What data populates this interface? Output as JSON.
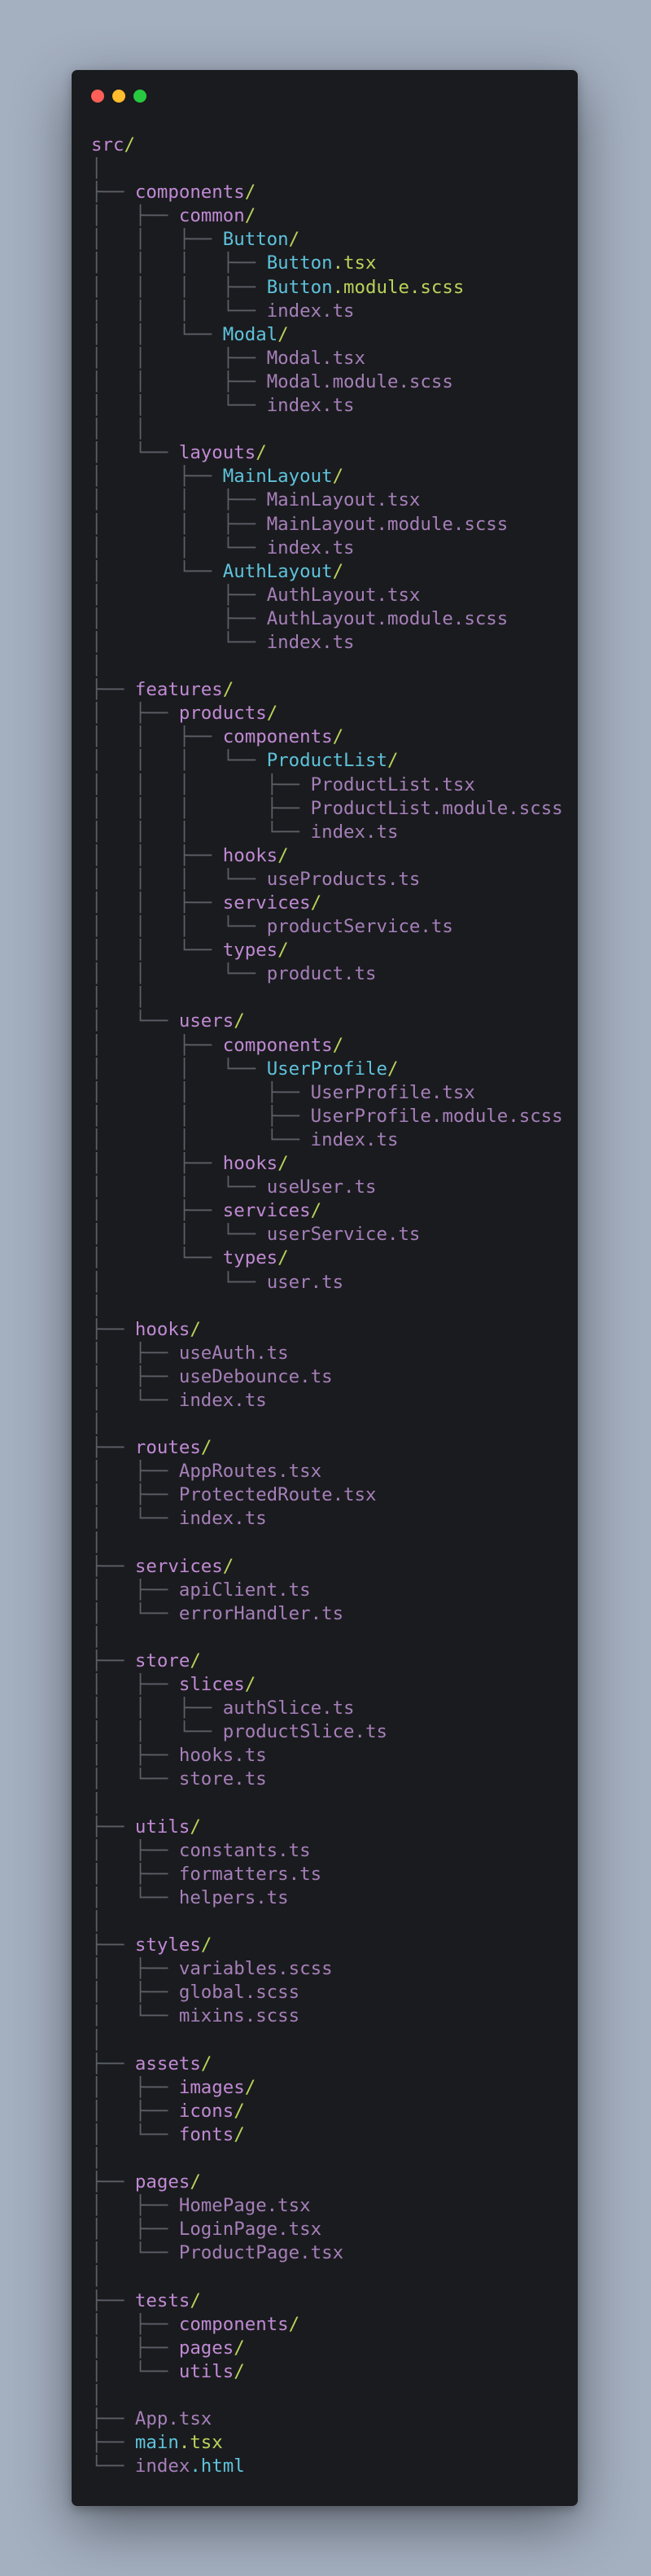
{
  "window": {
    "controls": [
      {
        "name": "close",
        "color": "#ff5f57"
      },
      {
        "name": "minimize",
        "color": "#febc2e"
      },
      {
        "name": "zoom",
        "color": "#28c840"
      }
    ]
  },
  "colors": {
    "background": "#a4afc0",
    "window": "#1a1b1e",
    "tree_chars": "#5b5f66",
    "directory": "#c08ad4",
    "file": "#a57fb9",
    "highlight": "#5ec3dc",
    "slash_and_extension": "#b8d35a"
  },
  "tree": [
    {
      "prefix": "",
      "name": "src",
      "suffix": "/",
      "kind": "dir"
    },
    {
      "prefix": "│",
      "name": "",
      "suffix": "",
      "kind": "blank"
    },
    {
      "prefix": "├── ",
      "name": "components",
      "suffix": "/",
      "kind": "dir"
    },
    {
      "prefix": "│   ├── ",
      "name": "common",
      "suffix": "/",
      "kind": "dir"
    },
    {
      "prefix": "│   │   ├── ",
      "name": "Button",
      "suffix": "/",
      "kind": "cyan"
    },
    {
      "prefix": "│   │   │   ├── ",
      "name": "Button",
      "suffix": ".tsx",
      "kind": "cyan-green"
    },
    {
      "prefix": "│   │   │   ├── ",
      "name": "Button",
      "suffix": ".module.scss",
      "kind": "cyan-green"
    },
    {
      "prefix": "│   │   │   └── ",
      "name": "index.ts",
      "suffix": "",
      "kind": "file"
    },
    {
      "prefix": "│   │   └── ",
      "name": "Modal",
      "suffix": "/",
      "kind": "cyan"
    },
    {
      "prefix": "│   │       ├── ",
      "name": "Modal.tsx",
      "suffix": "",
      "kind": "file"
    },
    {
      "prefix": "│   │       ├── ",
      "name": "Modal.module.scss",
      "suffix": "",
      "kind": "file"
    },
    {
      "prefix": "│   │       └── ",
      "name": "index.ts",
      "suffix": "",
      "kind": "file"
    },
    {
      "prefix": "│   │",
      "name": "",
      "suffix": "",
      "kind": "blank"
    },
    {
      "prefix": "│   └── ",
      "name": "layouts",
      "suffix": "/",
      "kind": "dir"
    },
    {
      "prefix": "│       ├── ",
      "name": "MainLayout",
      "suffix": "/",
      "kind": "cyan"
    },
    {
      "prefix": "│       │   ├── ",
      "name": "MainLayout.tsx",
      "suffix": "",
      "kind": "file"
    },
    {
      "prefix": "│       │   ├── ",
      "name": "MainLayout.module.scss",
      "suffix": "",
      "kind": "file"
    },
    {
      "prefix": "│       │   └── ",
      "name": "index.ts",
      "suffix": "",
      "kind": "file"
    },
    {
      "prefix": "│       └── ",
      "name": "AuthLayout",
      "suffix": "/",
      "kind": "cyan"
    },
    {
      "prefix": "│           ├── ",
      "name": "AuthLayout.tsx",
      "suffix": "",
      "kind": "file"
    },
    {
      "prefix": "│           ├── ",
      "name": "AuthLayout.module.scss",
      "suffix": "",
      "kind": "file"
    },
    {
      "prefix": "│           └── ",
      "name": "index.ts",
      "suffix": "",
      "kind": "file"
    },
    {
      "prefix": "│",
      "name": "",
      "suffix": "",
      "kind": "blank"
    },
    {
      "prefix": "├── ",
      "name": "features",
      "suffix": "/",
      "kind": "dir"
    },
    {
      "prefix": "│   ├── ",
      "name": "products",
      "suffix": "/",
      "kind": "dir"
    },
    {
      "prefix": "│   │   ├── ",
      "name": "components",
      "suffix": "/",
      "kind": "dir"
    },
    {
      "prefix": "│   │   │   └── ",
      "name": "ProductList",
      "suffix": "/",
      "kind": "cyan"
    },
    {
      "prefix": "│   │   │       ├── ",
      "name": "ProductList.tsx",
      "suffix": "",
      "kind": "file"
    },
    {
      "prefix": "│   │   │       ├── ",
      "name": "ProductList.module.scss",
      "suffix": "",
      "kind": "file"
    },
    {
      "prefix": "│   │   │       └── ",
      "name": "index.ts",
      "suffix": "",
      "kind": "file"
    },
    {
      "prefix": "│   │   ├── ",
      "name": "hooks",
      "suffix": "/",
      "kind": "dir"
    },
    {
      "prefix": "│   │   │   └── ",
      "name": "useProducts.ts",
      "suffix": "",
      "kind": "file"
    },
    {
      "prefix": "│   │   ├── ",
      "name": "services",
      "suffix": "/",
      "kind": "dir"
    },
    {
      "prefix": "│   │   │   └── ",
      "name": "productService.ts",
      "suffix": "",
      "kind": "file"
    },
    {
      "prefix": "│   │   └── ",
      "name": "types",
      "suffix": "/",
      "kind": "dir"
    },
    {
      "prefix": "│   │       └── ",
      "name": "product.ts",
      "suffix": "",
      "kind": "file"
    },
    {
      "prefix": "│   │",
      "name": "",
      "suffix": "",
      "kind": "blank"
    },
    {
      "prefix": "│   └── ",
      "name": "users",
      "suffix": "/",
      "kind": "dir"
    },
    {
      "prefix": "│       ├── ",
      "name": "components",
      "suffix": "/",
      "kind": "dir"
    },
    {
      "prefix": "│       │   └── ",
      "name": "UserProfile",
      "suffix": "/",
      "kind": "cyan"
    },
    {
      "prefix": "│       │       ├── ",
      "name": "UserProfile.tsx",
      "suffix": "",
      "kind": "file"
    },
    {
      "prefix": "│       │       ├── ",
      "name": "UserProfile.module.scss",
      "suffix": "",
      "kind": "file"
    },
    {
      "prefix": "│       │       └── ",
      "name": "index.ts",
      "suffix": "",
      "kind": "file"
    },
    {
      "prefix": "│       ├── ",
      "name": "hooks",
      "suffix": "/",
      "kind": "dir"
    },
    {
      "prefix": "│       │   └── ",
      "name": "useUser.ts",
      "suffix": "",
      "kind": "file"
    },
    {
      "prefix": "│       ├── ",
      "name": "services",
      "suffix": "/",
      "kind": "dir"
    },
    {
      "prefix": "│       │   └── ",
      "name": "userService.ts",
      "suffix": "",
      "kind": "file"
    },
    {
      "prefix": "│       └── ",
      "name": "types",
      "suffix": "/",
      "kind": "dir"
    },
    {
      "prefix": "│           └── ",
      "name": "user.ts",
      "suffix": "",
      "kind": "file"
    },
    {
      "prefix": "│",
      "name": "",
      "suffix": "",
      "kind": "blank"
    },
    {
      "prefix": "├── ",
      "name": "hooks",
      "suffix": "/",
      "kind": "dir"
    },
    {
      "prefix": "│   ├── ",
      "name": "useAuth.ts",
      "suffix": "",
      "kind": "file"
    },
    {
      "prefix": "│   ├── ",
      "name": "useDebounce.ts",
      "suffix": "",
      "kind": "file"
    },
    {
      "prefix": "│   └── ",
      "name": "index.ts",
      "suffix": "",
      "kind": "file"
    },
    {
      "prefix": "│",
      "name": "",
      "suffix": "",
      "kind": "blank"
    },
    {
      "prefix": "├── ",
      "name": "routes",
      "suffix": "/",
      "kind": "dir"
    },
    {
      "prefix": "│   ├── ",
      "name": "AppRoutes.tsx",
      "suffix": "",
      "kind": "file"
    },
    {
      "prefix": "│   ├── ",
      "name": "ProtectedRoute.tsx",
      "suffix": "",
      "kind": "file"
    },
    {
      "prefix": "│   └── ",
      "name": "index.ts",
      "suffix": "",
      "kind": "file"
    },
    {
      "prefix": "│",
      "name": "",
      "suffix": "",
      "kind": "blank"
    },
    {
      "prefix": "├── ",
      "name": "services",
      "suffix": "/",
      "kind": "dir"
    },
    {
      "prefix": "│   ├── ",
      "name": "apiClient.ts",
      "suffix": "",
      "kind": "file"
    },
    {
      "prefix": "│   └── ",
      "name": "errorHandler.ts",
      "suffix": "",
      "kind": "file"
    },
    {
      "prefix": "│",
      "name": "",
      "suffix": "",
      "kind": "blank"
    },
    {
      "prefix": "├── ",
      "name": "store",
      "suffix": "/",
      "kind": "dir"
    },
    {
      "prefix": "│   ├── ",
      "name": "slices",
      "suffix": "/",
      "kind": "dir"
    },
    {
      "prefix": "│   │   ├── ",
      "name": "authSlice.ts",
      "suffix": "",
      "kind": "file"
    },
    {
      "prefix": "│   │   └── ",
      "name": "productSlice.ts",
      "suffix": "",
      "kind": "file"
    },
    {
      "prefix": "│   ├── ",
      "name": "hooks.ts",
      "suffix": "",
      "kind": "file"
    },
    {
      "prefix": "│   └── ",
      "name": "store.ts",
      "suffix": "",
      "kind": "file"
    },
    {
      "prefix": "│",
      "name": "",
      "suffix": "",
      "kind": "blank"
    },
    {
      "prefix": "├── ",
      "name": "utils",
      "suffix": "/",
      "kind": "dir"
    },
    {
      "prefix": "│   ├── ",
      "name": "constants.ts",
      "suffix": "",
      "kind": "file"
    },
    {
      "prefix": "│   ├── ",
      "name": "formatters.ts",
      "suffix": "",
      "kind": "file"
    },
    {
      "prefix": "│   └── ",
      "name": "helpers.ts",
      "suffix": "",
      "kind": "file"
    },
    {
      "prefix": "│",
      "name": "",
      "suffix": "",
      "kind": "blank"
    },
    {
      "prefix": "├── ",
      "name": "styles",
      "suffix": "/",
      "kind": "dir"
    },
    {
      "prefix": "│   ├── ",
      "name": "variables.scss",
      "suffix": "",
      "kind": "file"
    },
    {
      "prefix": "│   ├── ",
      "name": "global.scss",
      "suffix": "",
      "kind": "file"
    },
    {
      "prefix": "│   └── ",
      "name": "mixins.scss",
      "suffix": "",
      "kind": "file"
    },
    {
      "prefix": "│",
      "name": "",
      "suffix": "",
      "kind": "blank"
    },
    {
      "prefix": "├── ",
      "name": "assets",
      "suffix": "/",
      "kind": "dir"
    },
    {
      "prefix": "│   ├── ",
      "name": "images",
      "suffix": "/",
      "kind": "dir"
    },
    {
      "prefix": "│   ├── ",
      "name": "icons",
      "suffix": "/",
      "kind": "dir"
    },
    {
      "prefix": "│   └── ",
      "name": "fonts",
      "suffix": "/",
      "kind": "dir"
    },
    {
      "prefix": "│",
      "name": "",
      "suffix": "",
      "kind": "blank"
    },
    {
      "prefix": "├── ",
      "name": "pages",
      "suffix": "/",
      "kind": "dir"
    },
    {
      "prefix": "│   ├── ",
      "name": "HomePage.tsx",
      "suffix": "",
      "kind": "file"
    },
    {
      "prefix": "│   ├── ",
      "name": "LoginPage.tsx",
      "suffix": "",
      "kind": "file"
    },
    {
      "prefix": "│   └── ",
      "name": "ProductPage.tsx",
      "suffix": "",
      "kind": "file"
    },
    {
      "prefix": "│",
      "name": "",
      "suffix": "",
      "kind": "blank"
    },
    {
      "prefix": "├── ",
      "name": "tests",
      "suffix": "/",
      "kind": "dir"
    },
    {
      "prefix": "│   ├── ",
      "name": "components",
      "suffix": "/",
      "kind": "dir"
    },
    {
      "prefix": "│   ├── ",
      "name": "pages",
      "suffix": "/",
      "kind": "dir"
    },
    {
      "prefix": "│   └── ",
      "name": "utils",
      "suffix": "/",
      "kind": "dir"
    },
    {
      "prefix": "│",
      "name": "",
      "suffix": "",
      "kind": "blank"
    },
    {
      "prefix": "├── ",
      "name": "App.tsx",
      "suffix": "",
      "kind": "file"
    },
    {
      "prefix": "├── ",
      "name": "main",
      "suffix": ".tsx",
      "kind": "cyan-green"
    },
    {
      "prefix": "└── ",
      "name": "index",
      "suffix": ".html",
      "kind": "file-cyan"
    }
  ]
}
